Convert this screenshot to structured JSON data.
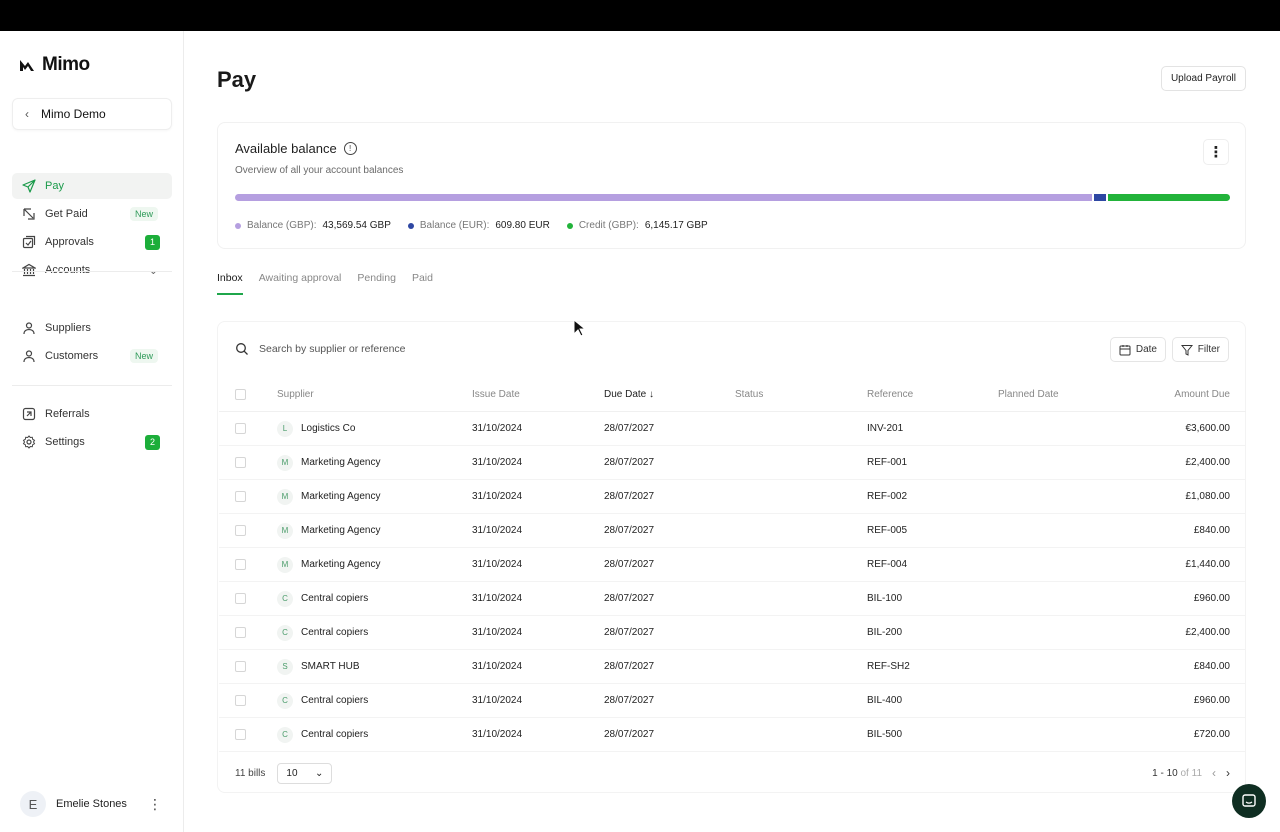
{
  "app": {
    "name": "Mimo"
  },
  "org": {
    "name": "Mimo Demo"
  },
  "nav": {
    "primary": [
      {
        "label": "Pay",
        "icon": "send-icon",
        "active": true
      },
      {
        "label": "Get Paid",
        "icon": "get-paid-icon",
        "badge": "New"
      },
      {
        "label": "Approvals",
        "icon": "approvals-icon",
        "count": "1"
      },
      {
        "label": "Accounts",
        "icon": "bank-icon"
      }
    ],
    "secondary": [
      {
        "label": "Suppliers",
        "icon": "user-icon"
      },
      {
        "label": "Customers",
        "icon": "user-icon",
        "badge": "New"
      }
    ],
    "tertiary": [
      {
        "label": "Referrals",
        "icon": "referrals-icon"
      },
      {
        "label": "Settings",
        "icon": "gear-icon",
        "count": "2"
      }
    ]
  },
  "user": {
    "initial": "E",
    "name": "Emelie Stones"
  },
  "page": {
    "title": "Pay",
    "upload_label": "Upload Payroll"
  },
  "balance": {
    "title": "Available balance",
    "subtitle": "Overview of all your account balances",
    "items": [
      {
        "label": "Balance (GBP):",
        "value": "43,569.54 GBP",
        "color": "#b59fe0",
        "share": 0.865
      },
      {
        "label": "Balance (EUR):",
        "value": "609.80 EUR",
        "color": "#2e47a3",
        "share": 0.012
      },
      {
        "label": "Credit (GBP):",
        "value": "6,145.17 GBP",
        "color": "#22b33a",
        "share": 0.123
      }
    ]
  },
  "tabs": [
    "Inbox",
    "Awaiting approval",
    "Pending",
    "Paid"
  ],
  "search": {
    "placeholder": "Search by supplier or reference"
  },
  "toolbar": {
    "date_label": "Date",
    "filter_label": "Filter"
  },
  "table": {
    "columns": [
      "Supplier",
      "Issue Date",
      "Due Date",
      "Status",
      "Reference",
      "Planned Date",
      "Amount Due"
    ],
    "rows": [
      {
        "initial": "L",
        "supplier": "Logistics Co",
        "issue": "31/10/2024",
        "due": "28/07/2027",
        "status": "",
        "ref": "INV-201",
        "planned": "",
        "amount": "€3,600.00"
      },
      {
        "initial": "M",
        "supplier": "Marketing Agency",
        "issue": "31/10/2024",
        "due": "28/07/2027",
        "status": "",
        "ref": "REF-001",
        "planned": "",
        "amount": "£2,400.00"
      },
      {
        "initial": "M",
        "supplier": "Marketing Agency",
        "issue": "31/10/2024",
        "due": "28/07/2027",
        "status": "",
        "ref": "REF-002",
        "planned": "",
        "amount": "£1,080.00"
      },
      {
        "initial": "M",
        "supplier": "Marketing Agency",
        "issue": "31/10/2024",
        "due": "28/07/2027",
        "status": "",
        "ref": "REF-005",
        "planned": "",
        "amount": "£840.00"
      },
      {
        "initial": "M",
        "supplier": "Marketing Agency",
        "issue": "31/10/2024",
        "due": "28/07/2027",
        "status": "",
        "ref": "REF-004",
        "planned": "",
        "amount": "£1,440.00"
      },
      {
        "initial": "C",
        "supplier": "Central copiers",
        "issue": "31/10/2024",
        "due": "28/07/2027",
        "status": "",
        "ref": "BIL-100",
        "planned": "",
        "amount": "£960.00"
      },
      {
        "initial": "C",
        "supplier": "Central copiers",
        "issue": "31/10/2024",
        "due": "28/07/2027",
        "status": "",
        "ref": "BIL-200",
        "planned": "",
        "amount": "£2,400.00"
      },
      {
        "initial": "S",
        "supplier": "SMART HUB",
        "issue": "31/10/2024",
        "due": "28/07/2027",
        "status": "",
        "ref": "REF-SH2",
        "planned": "",
        "amount": "£840.00"
      },
      {
        "initial": "C",
        "supplier": "Central copiers",
        "issue": "31/10/2024",
        "due": "28/07/2027",
        "status": "",
        "ref": "BIL-400",
        "planned": "",
        "amount": "£960.00"
      },
      {
        "initial": "C",
        "supplier": "Central copiers",
        "issue": "31/10/2024",
        "due": "28/07/2027",
        "status": "",
        "ref": "BIL-500",
        "planned": "",
        "amount": "£720.00"
      }
    ]
  },
  "footer": {
    "count_label": "11 bills",
    "per_page": "10",
    "range": "1 - 10",
    "of_total": "of 11"
  }
}
